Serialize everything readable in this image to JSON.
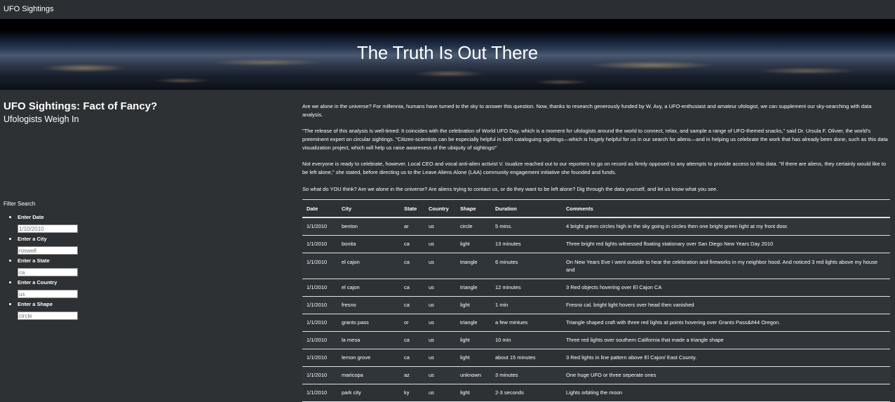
{
  "navbar": {
    "brand": "UFO Sightings"
  },
  "hero": {
    "title": "The Truth Is Out There"
  },
  "page": {
    "title": "UFO Sightings: Fact of Fancy?",
    "subtitle": "Ufologists Weigh In"
  },
  "filters": {
    "title": "Filter Search",
    "fields": [
      {
        "label": "Enter Date",
        "placeholder": "1/10/2010"
      },
      {
        "label": "Enter a City",
        "placeholder": "roswell"
      },
      {
        "label": "Enter a State",
        "placeholder": "ca"
      },
      {
        "label": "Enter a Country",
        "placeholder": "us"
      },
      {
        "label": "Enter a Shape",
        "placeholder": "circle"
      }
    ]
  },
  "article": {
    "paragraphs": [
      "Are we alone in the universe? For millennia, humans have turned to the sky to answer this question. Now, thanks to research generously funded by W. Avy, a UFO-enthusiast and amateur ufologist, we can supplement our sky-searching with data analysis.",
      "\"The release of this analysis is well-timed: It coincides with the celebration of World UFO Day, which is a moment for ufologists around the world to connect, relax, and sample a range of UFO-themed snacks,\" said Dr. Ursula F. Olivier, the world's preeminent expert on circular sightings. \"Citizen-scientists can be especially helpful in both cataloguing sightings—which is hugely helpful for us in our search for aliens—and in helping us celebrate the work that has already been done, such as this data visualization project, which will help us raise awareness of the ubiquity of sightings!\"",
      "Not everyone is ready to celebrate, however. Local CEO and vocal anti-alien activist V. Isualize reached out to our reporters to go on record as firmly opposed to any attempts to provide access to this data. \"If there are aliens, they certainly would like to be left alone,\" she stated, before directing us to the Leave Aliens Alone (LAA) community engagement initiative she founded and funds.",
      "So what do YOU think? Are we alone in the universe? Are aliens trying to contact us, or do they want to be left alone? Dig through the data yourself, and let us know what you see."
    ]
  },
  "table": {
    "headers": [
      "Date",
      "City",
      "State",
      "Country",
      "Shape",
      "Duration",
      "Comments"
    ],
    "rows": [
      [
        "1/1/2010",
        "benton",
        "ar",
        "us",
        "circle",
        "5 mins.",
        "4 bright green circles high in the sky going in circles then one bright green light at my front door."
      ],
      [
        "1/1/2010",
        "bonita",
        "ca",
        "us",
        "light",
        "13 minutes",
        "Three bright red lights witnessed floating stationary over San Diego New Years Day 2010"
      ],
      [
        "1/1/2010",
        "el cajon",
        "ca",
        "us",
        "triangle",
        "6 minutes",
        "On New Years Eve I went outside to hear the celebration and fireworks in my neighbor hood. And noticed 3 red lights above my house and"
      ],
      [
        "1/1/2010",
        "el cajon",
        "ca",
        "us",
        "triangle",
        "12 minutes",
        "3 Red objects hovering over El Cajon CA"
      ],
      [
        "1/1/2010",
        "fresno",
        "ca",
        "us",
        "light",
        "1 min",
        "Fresno cal. bright light hovers over head then vanished"
      ],
      [
        "1/1/2010",
        "grants pass",
        "or",
        "us",
        "triangle",
        "a few mintues",
        "Triangle shaped craft with three red lights at points hovering over Grants Pass&#44 Oregon."
      ],
      [
        "1/1/2010",
        "la mesa",
        "ca",
        "us",
        "light",
        "10 min",
        "Three red lights over southern California that made a triangle shape"
      ],
      [
        "1/1/2010",
        "lemon grove",
        "ca",
        "us",
        "light",
        "about 15 minutes",
        "3 Red lights in line pattern above El Cajon/ East County."
      ],
      [
        "1/1/2010",
        "maricopa",
        "az",
        "us",
        "unknown",
        "3 minutes",
        "One huge UFO or three seperate ones"
      ],
      [
        "1/1/2010",
        "park city",
        "ky",
        "us",
        "light",
        "2-3 seconds",
        "Lights orbiting the moon"
      ]
    ]
  }
}
